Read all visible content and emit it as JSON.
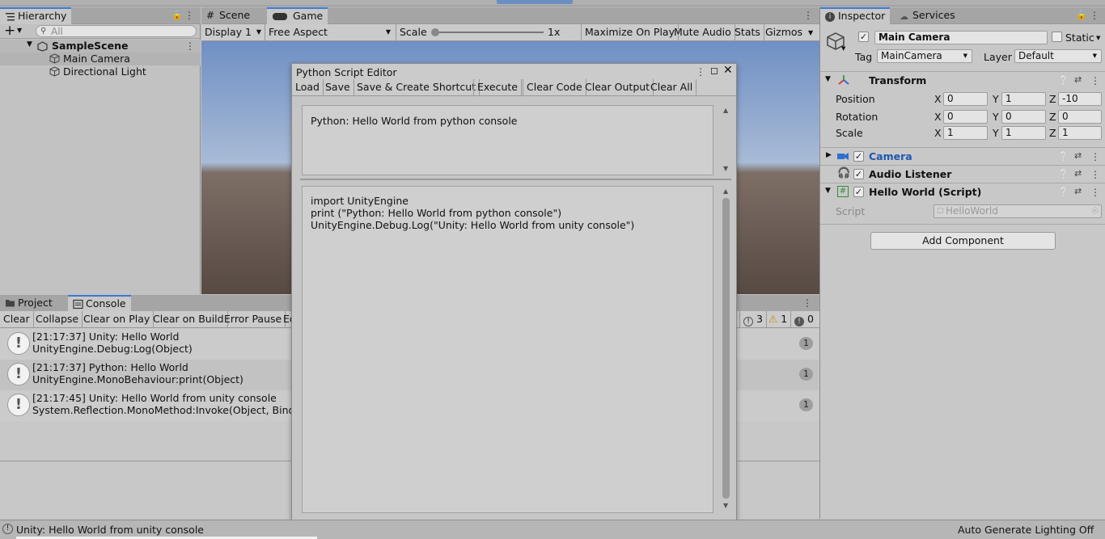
{
  "hierarchy": {
    "tab_label": "Hierarchy",
    "search_placeholder": "All",
    "scene_name": "SampleScene",
    "items": [
      "Main Camera",
      "Directional Light"
    ]
  },
  "center_tabs": {
    "scene": "Scene",
    "game": "Game"
  },
  "game_toolbar": {
    "display": "Display 1",
    "aspect": "Free Aspect",
    "scale_label": "Scale",
    "scale_value": "1x",
    "maximize": "Maximize On Play",
    "mute": "Mute Audio",
    "stats": "Stats",
    "gizmos": "Gizmos"
  },
  "bottom_tabs": {
    "project": "Project",
    "console": "Console"
  },
  "console": {
    "toolbar": [
      "Clear",
      "Collapse",
      "Clear on Play",
      "Clear on Build",
      "Error Pause",
      "Ed"
    ],
    "counts": {
      "info": "3",
      "warn": "1",
      "error": "0"
    },
    "messages": [
      {
        "line1": "[21:17:37] Unity: Hello World",
        "line2": "UnityEngine.Debug:Log(Object)",
        "count": "1"
      },
      {
        "line1": "[21:17:37] Python: Hello World",
        "line2": "UnityEngine.MonoBehaviour:print(Object)",
        "count": "1"
      },
      {
        "line1": "[21:17:45] Unity: Hello World from unity console",
        "line2": "System.Reflection.MonoMethod:Invoke(Object, BindingFl",
        "count": "1"
      }
    ]
  },
  "python_editor": {
    "title": "Python Script Editor",
    "buttons": [
      "Load",
      "Save",
      "Save & Create Shortcut",
      "Execute",
      "Clear Code",
      "Clear Output",
      "Clear All"
    ],
    "output_text": "Python: Hello World from python console",
    "code_lines": [
      "import UnityEngine",
      "print (\"Python: Hello World from python console\")",
      "UnityEngine.Debug.Log(\"Unity: Hello World from unity console\")"
    ]
  },
  "inspector": {
    "tab_label": "Inspector",
    "services_label": "Services",
    "object_name": "Main Camera",
    "static_label": "Static",
    "tag_label": "Tag",
    "tag_value": "MainCamera",
    "layer_label": "Layer",
    "layer_value": "Default",
    "transform": {
      "title": "Transform",
      "rows": [
        {
          "label": "Position",
          "x": "0",
          "y": "1",
          "z": "-10"
        },
        {
          "label": "Rotation",
          "x": "0",
          "y": "0",
          "z": "0"
        },
        {
          "label": "Scale",
          "x": "1",
          "y": "1",
          "z": "1"
        }
      ],
      "axis_x": "X",
      "axis_y": "Y",
      "axis_z": "Z"
    },
    "components": [
      "Camera",
      "Audio Listener",
      "Hello World (Script)"
    ],
    "script_label": "Script",
    "script_value": "HelloWorld",
    "add_component": "Add Component"
  },
  "status_bar": {
    "message": "Unity: Hello World from unity console",
    "lighting": "Auto Generate Lighting Off"
  },
  "colors": {
    "accent": "#3a79d0",
    "panel": "#c2c2c2",
    "header": "#a5a5a5"
  }
}
